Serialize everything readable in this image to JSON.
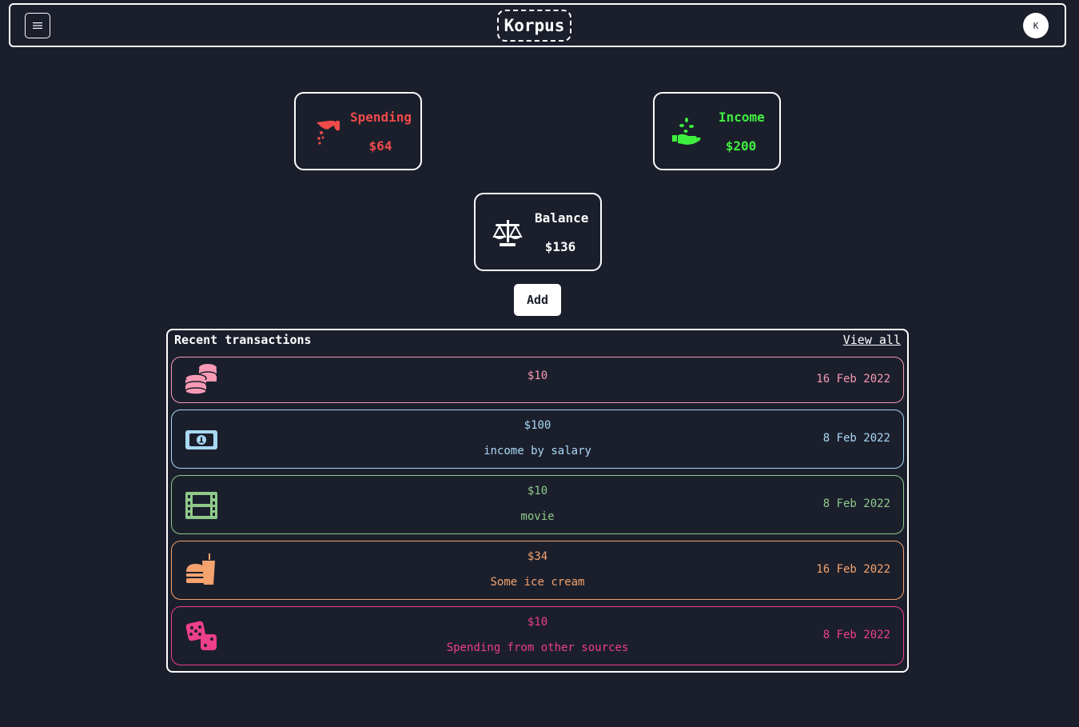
{
  "navbar": {
    "brand": "Korpus",
    "avatar_initial": "K",
    "menu_icon": "hamburger-icon"
  },
  "summary": {
    "spending": {
      "label": "Spending",
      "value": "$64",
      "icon": "hand-dropping-coins-icon",
      "color": "#f04a4a"
    },
    "income": {
      "label": "Income",
      "value": "$200",
      "icon": "hand-receiving-seeds-icon",
      "color": "#3ef03e"
    },
    "balance": {
      "label": "Balance",
      "value": "$136",
      "icon": "balance-scale-icon",
      "color": "#ffffff"
    }
  },
  "actions": {
    "add_label": "Add"
  },
  "recent": {
    "title": "Recent transactions",
    "view_all": "View all",
    "items": [
      {
        "amount": "$10",
        "description": "",
        "date": "16 Feb 2022",
        "icon": "coins-stack-icon",
        "color": "#f79ab4"
      },
      {
        "amount": "$100",
        "description": "income by salary",
        "date": "8 Feb 2022",
        "icon": "money-bill-icon",
        "color": "#a9d8f5"
      },
      {
        "amount": "$10",
        "description": "movie",
        "date": "8 Feb 2022",
        "icon": "film-icon",
        "color": "#8fc98a"
      },
      {
        "amount": "$34",
        "description": "Some ice cream",
        "date": "16 Feb 2022",
        "icon": "burger-soda-icon",
        "color": "#f5a36e"
      },
      {
        "amount": "$10",
        "description": "Spending from other sources",
        "date": "8 Feb 2022",
        "icon": "dice-icon",
        "color": "#ee3f8a"
      }
    ]
  }
}
